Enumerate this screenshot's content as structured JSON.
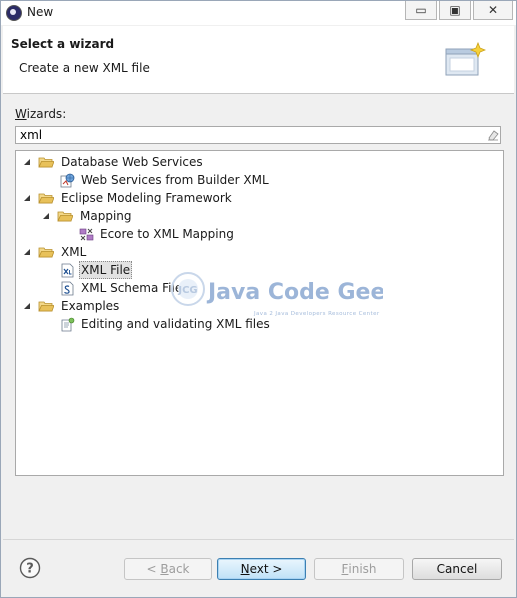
{
  "window": {
    "title": "New",
    "controls": {
      "minimize": "▭",
      "restore": "▣",
      "close": "✕"
    }
  },
  "banner": {
    "title": "Select a wizard",
    "subtitle": "Create a new XML file"
  },
  "wizards": {
    "label_accel": "W",
    "label_rest": "izards:",
    "filter_value": "xml"
  },
  "tree": {
    "items": [
      {
        "label": "Database Web Services",
        "type": "folder",
        "expanded": true
      },
      {
        "label": "Web Services from Builder XML",
        "type": "item",
        "icon": "web-services-icon"
      },
      {
        "label": "Eclipse Modeling Framework",
        "type": "folder",
        "expanded": true
      },
      {
        "label": "Mapping",
        "type": "folder",
        "expanded": true
      },
      {
        "label": "Ecore to XML Mapping",
        "type": "item",
        "icon": "ecore-mapping-icon"
      },
      {
        "label": "XML",
        "type": "folder",
        "expanded": true
      },
      {
        "label": "XML File",
        "type": "item",
        "icon": "xml-file-icon",
        "selected": true
      },
      {
        "label": "XML Schema File",
        "type": "item",
        "icon": "xml-schema-icon"
      },
      {
        "label": "Examples",
        "type": "folder",
        "expanded": true
      },
      {
        "label": "Editing and validating XML files",
        "type": "item",
        "icon": "examples-icon"
      }
    ]
  },
  "watermark": {
    "logo_letters": "JCG",
    "name": "Java Code Geeks",
    "tagline": "Java 2 Java Developers Resource Center"
  },
  "buttons": {
    "back_accel": "B",
    "back_pre": "< ",
    "back_post": "ack",
    "next_accel": "N",
    "next_post": "ext >",
    "finish_accel": "F",
    "finish_post": "inish",
    "cancel": "Cancel"
  },
  "help": {
    "glyph": "?"
  },
  "colors": {
    "folder": "#e8c15a",
    "selection": "#e2e2e2",
    "watermark_blue": "#4a78b8"
  }
}
